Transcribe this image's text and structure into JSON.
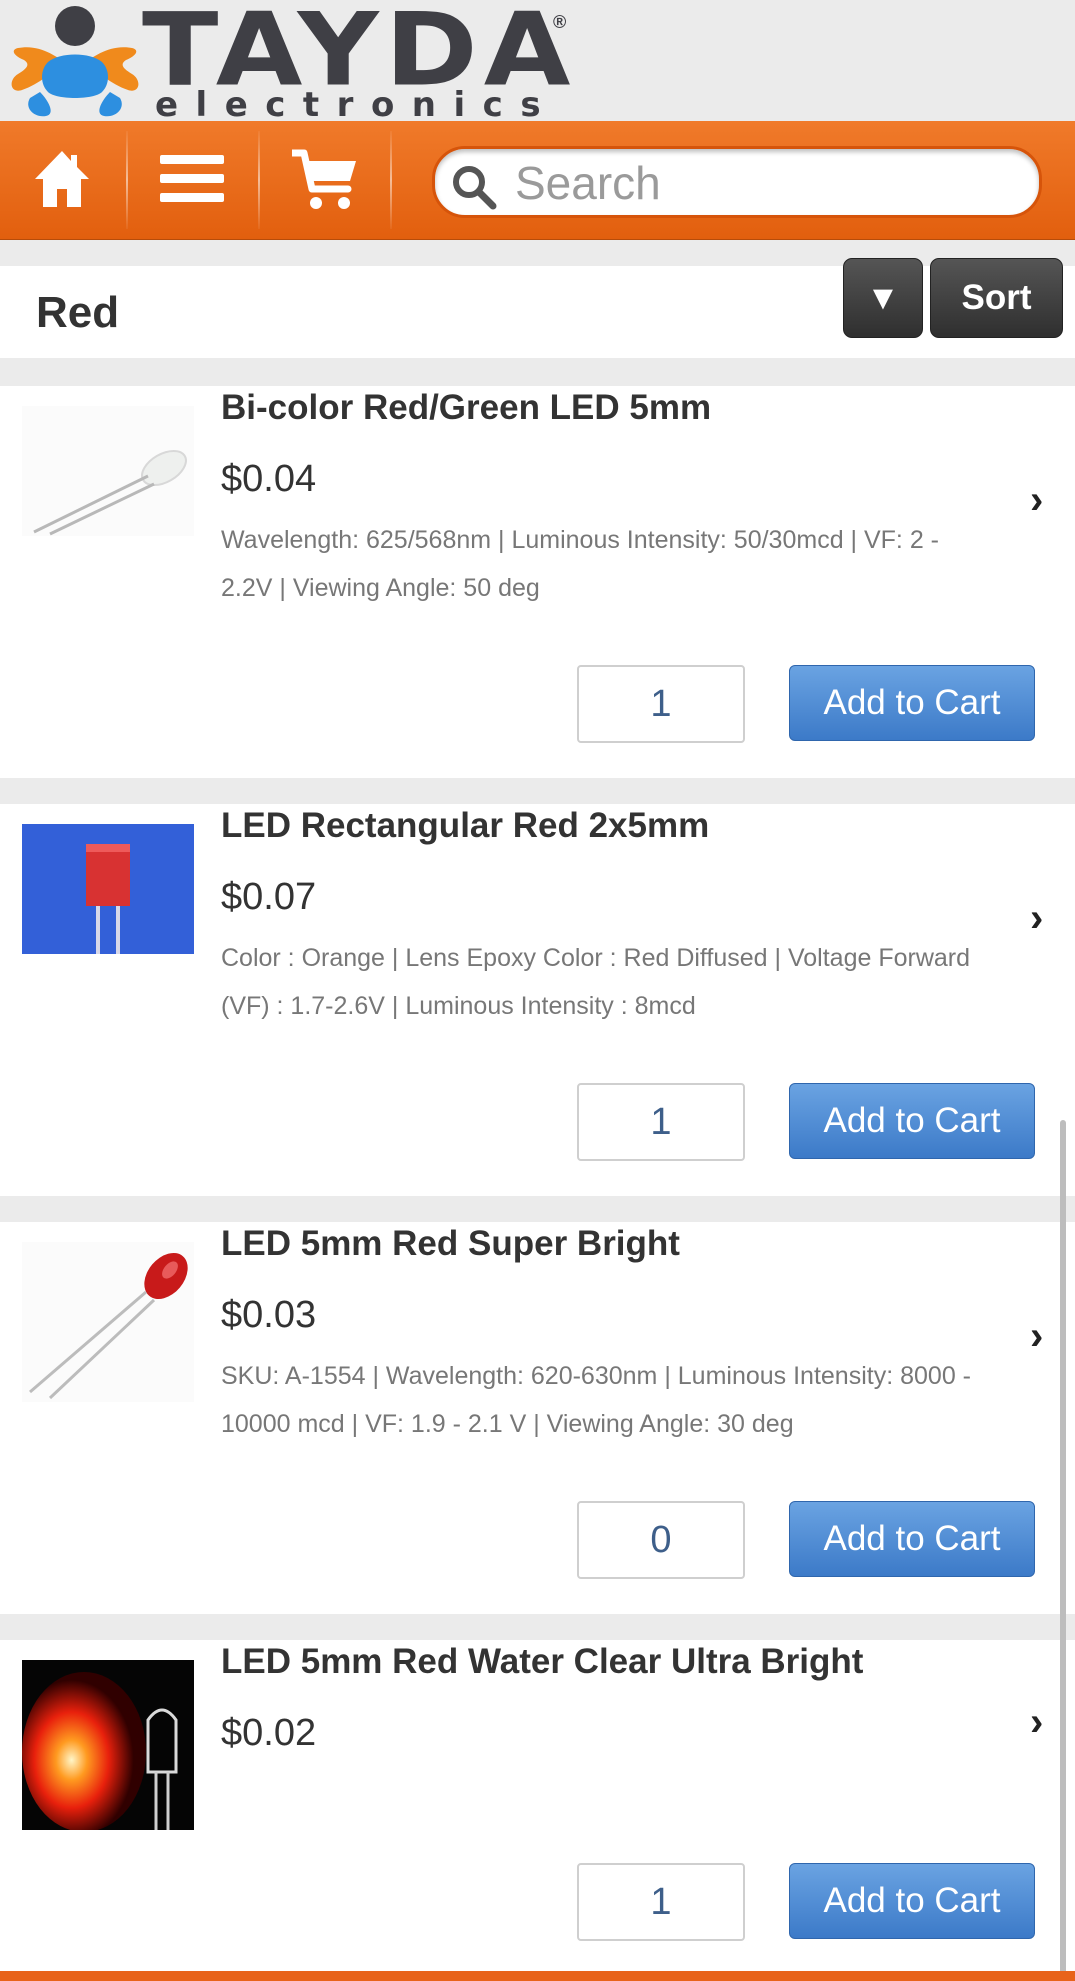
{
  "logo": {
    "word": "TAYDA",
    "sub": "electronics",
    "reg": "®"
  },
  "nav": {
    "home_icon": "home-icon",
    "menu_icon": "menu-icon",
    "cart_icon": "cart-icon",
    "search_placeholder": "Search"
  },
  "category": {
    "title": "Red",
    "dropdown_glyph": "▼",
    "sort_label": "Sort"
  },
  "products": [
    {
      "name": "Bi-color Red/Green LED 5mm",
      "price": "$0.04",
      "desc": "Wavelength: 625/568nm | Luminous Intensity: 50/30mcd | VF: 2 - 2.2V | Viewing Angle: 50 deg",
      "qty": "1",
      "add_label": "Add to Cart"
    },
    {
      "name": "LED Rectangular Red 2x5mm",
      "price": "$0.07",
      "desc": "Color : Orange | Lens Epoxy Color : Red Diffused | Voltage Forward (VF) : 1.7-2.6V | Luminous Intensity : 8mcd",
      "qty": "1",
      "add_label": "Add to Cart"
    },
    {
      "name": "LED 5mm Red Super Bright",
      "price": "$0.03",
      "desc": "SKU: A-1554 | Wavelength: 620-630nm | Luminous Intensity: 8000 - 10000 mcd | VF: 1.9 - 2.1 V | Viewing Angle: 30 deg",
      "qty": "0",
      "add_label": "Add to Cart"
    },
    {
      "name": "LED 5mm Red Water Clear Ultra Bright",
      "price": "$0.02",
      "desc": "",
      "qty": "1",
      "add_label": "Add to Cart"
    }
  ],
  "chevron": "›",
  "colors": {
    "brand_orange": "#e8631a",
    "button_blue": "#4a86d2",
    "dark_button": "#3a3a3a"
  }
}
